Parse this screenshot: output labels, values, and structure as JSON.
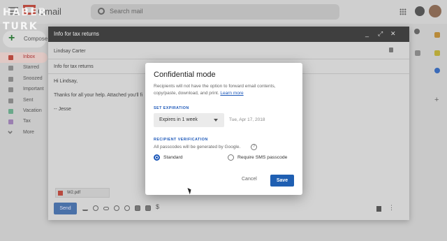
{
  "watermark": {
    "line1": "HABER",
    "line2": "TURK"
  },
  "app": {
    "name": "Gmail"
  },
  "search": {
    "placeholder": "Search mail"
  },
  "sidebar": {
    "compose_label": "Compose",
    "items": [
      {
        "label": "Inbox",
        "active": true
      },
      {
        "label": "Starred"
      },
      {
        "label": "Snoozed"
      },
      {
        "label": "Important"
      },
      {
        "label": "Sent"
      },
      {
        "label": "Vacation"
      },
      {
        "label": "Tax"
      },
      {
        "label": "More"
      }
    ]
  },
  "compose": {
    "title": "Info for tax returns",
    "to": "Lindsay Carter",
    "subject": "Info for tax returns",
    "body_greeting": "Hi Lindsay,",
    "body_line": "Thanks for all your help. Attached you'll fi",
    "signature": "-- Jesse",
    "attachment_name": "W2.pdf",
    "send_label": "Send"
  },
  "dialog": {
    "title": "Confidential mode",
    "description": "Recipients will not have the option to forward email contents, copy/paste, download, and print.",
    "learn_more": "Learn more",
    "set_expiration_label": "SET EXPIRATION",
    "expiration_value": "Expires in 1 week",
    "expiration_date": "Tue, Apr 17, 2018",
    "recipient_verification_label": "RECIPIENT VERIFICATION",
    "verification_note": "All passcodes will be generated by Google.",
    "option_standard": "Standard",
    "option_sms": "Require SMS passcode",
    "selected_option": "Standard",
    "cancel_label": "Cancel",
    "save_label": "Save"
  },
  "colors": {
    "accent": "#1f5fb2",
    "compose_header": "#3f3f3f",
    "brand_red": "#b84a3f"
  }
}
